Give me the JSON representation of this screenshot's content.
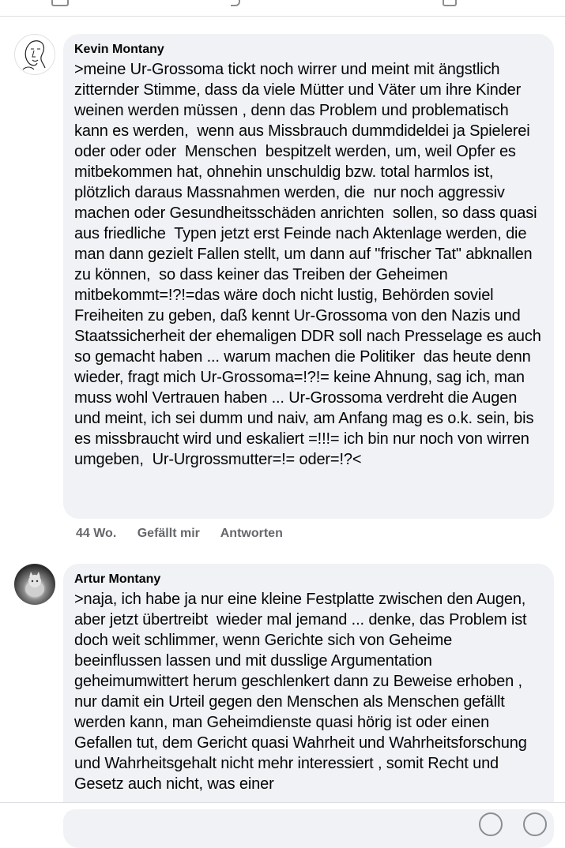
{
  "comments": [
    {
      "author": "Kevin Montany",
      "avatar_icon": "face-sketch-avatar",
      "text": ">meine Ur-Grossoma tickt noch wirrer und meint mit ängstlich zitternder Stimme, dass da viele Mütter und Väter um ihre Kinder weinen werden müssen , denn das Problem und problematisch kann es werden,  wenn aus Missbrauch dummdideldei ja Spielerei oder oder oder  Menschen  bespitzelt werden, um, weil Opfer es mitbekommen hat, ohnehin unschuldig bzw. total harmlos ist,  plötzlich daraus Massnahmen werden, die  nur noch aggressiv machen oder Gesundheitsschäden anrichten  sollen, so dass quasi aus friedliche  Typen jetzt erst Feinde nach Aktenlage werden, die man dann gezielt Fallen stellt, um dann auf \"frischer Tat\" abknallen zu können,  so dass keiner das Treiben der Geheimen mitbekommt=!?!=das wäre doch nicht lustig, Behörden soviel Freiheiten zu geben, daß kennt Ur-Grossoma von den Nazis und Staatssicherheit der ehemaligen DDR soll nach Presselage es auch so gemacht haben ... warum machen die Politiker  das heute denn wieder, fragt mich Ur-Grossoma=!?!= keine Ahnung, sag ich, man muss wohl Vertrauen haben ... Ur-Grossoma verdreht die Augen und meint, ich sei dumm und naiv, am Anfang mag es o.k. sein, bis es missbraucht wird und eskaliert =!!!= ich bin nur noch von wirren umgeben,  Ur-Urgrossmutter=!= oder=!?<",
      "time": "44 Wo.",
      "like_label": "Gefällt mir",
      "reply_label": "Antworten"
    },
    {
      "author": "Artur Montany",
      "avatar_icon": "cat-photo-avatar",
      "text": ">naja, ich habe ja nur eine kleine Festplatte zwischen den Augen, aber jetzt übertreibt  wieder mal jemand ... denke, das Problem ist doch weit schlimmer, wenn Gerichte sich von Geheime beeinflussen lassen und mit dusslige Argumentation geheimumwittert herum geschlenkert dann zu Beweise erhoben , nur damit ein Urteil gegen den Menschen als Menschen gefällt werden kann, man Geheimdienste quasi hörig ist oder einen Gefallen tut, dem Gericht quasi Wahrheit und Wahrheitsforschung und Wahrheitsgehalt nicht mehr interessiert , somit Recht und Gesetz auch nicht, was einer"
    }
  ],
  "colors": {
    "bubble": "#f0f2f5",
    "meta_text": "#65676b",
    "text": "#050505"
  }
}
